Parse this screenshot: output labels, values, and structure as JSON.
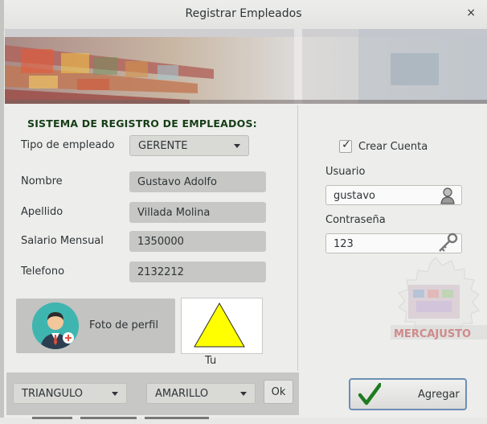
{
  "window": {
    "title": "Registrar Empleados",
    "close_glyph": "×"
  },
  "form": {
    "heading": "SISTEMA DE REGISTRO DE EMPLEADOS:",
    "tipo_label": "Tipo de empleado",
    "tipo_value": "GERENTE",
    "nombre_label": "Nombre",
    "nombre_value": "Gustavo Adolfo",
    "apellido_label": "Apellido",
    "apellido_value": "Villada Molina",
    "salario_label": "Salario Mensual",
    "salario_value": "1350000",
    "telefono_label": "Telefono",
    "telefono_value": "2132212",
    "photo_label": "Foto de perfil",
    "shape_caption": "Tu"
  },
  "shape_controls": {
    "shape_value": "TRIANGULO",
    "color_value": "AMARILLO",
    "ok_label": "Ok"
  },
  "account": {
    "create_label": "Crear Cuenta",
    "create_checked": true,
    "usuario_label": "Usuario",
    "usuario_value": "gustavo",
    "password_label": "Contraseña",
    "password_value": "123",
    "add_label": "Agregar"
  },
  "logo": {
    "text": "MERCAJUSTO"
  },
  "colors": {
    "heading": "#163d16",
    "triangle_fill": "#ffff00",
    "check_green": "#1f7a1f",
    "avatar_bg": "#3fb5b0"
  },
  "icons": [
    "close-icon",
    "user-icon",
    "key-icon",
    "checkmark-icon",
    "dropdown-arrow-icon"
  ]
}
